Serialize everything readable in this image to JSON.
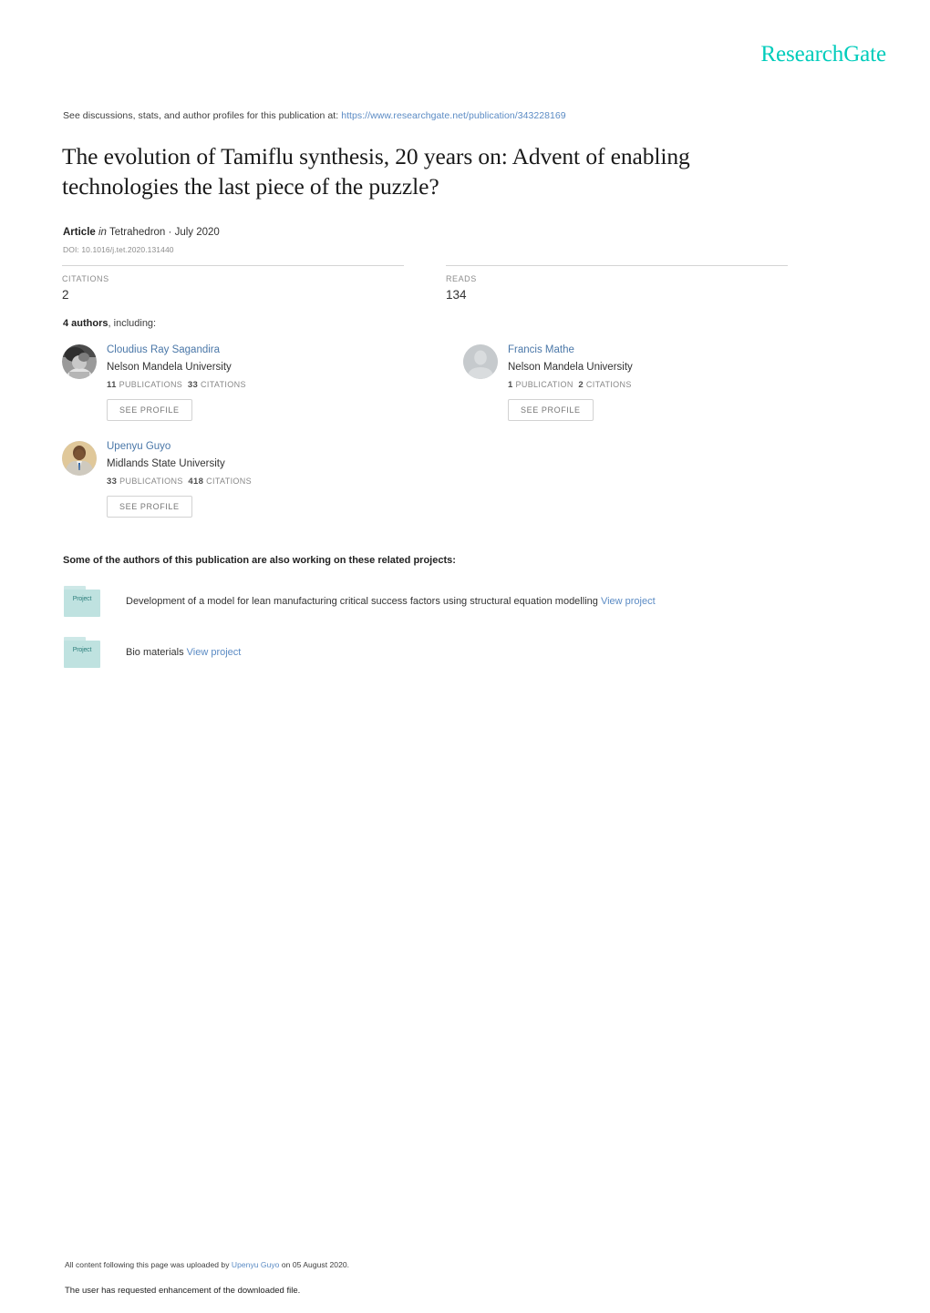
{
  "brand": {
    "name": "ResearchGate",
    "color": "#00ccbb"
  },
  "discussions": {
    "prefix": "See discussions, stats, and author profiles for this publication at:",
    "url": "https://www.researchgate.net/publication/343228169"
  },
  "publication": {
    "title": "The evolution of Tamiflu synthesis, 20 years on: Advent of enabling technologies the last piece of the puzzle?",
    "type": "Article",
    "in_word": "in",
    "journal": "Tetrahedron",
    "separator": "·",
    "date": "July 2020",
    "doi": "DOI: 10.1016/j.tet.2020.131440"
  },
  "stats": [
    {
      "label": "CITATIONS",
      "value": "2"
    },
    {
      "label": "READS",
      "value": "134"
    }
  ],
  "authors_section": {
    "count_text": "4 authors",
    "suffix": ", including:",
    "see_profile_label": "SEE PROFILE",
    "authors": [
      {
        "name": "Cloudius Ray Sagandira",
        "affiliation": "Nelson Mandela University",
        "publications_count": "11",
        "publications_label": "PUBLICATIONS",
        "citations_count": "33",
        "citations_label": "CITATIONS",
        "avatar_type": "photo-grayscale"
      },
      {
        "name": "Francis Mathe",
        "affiliation": "Nelson Mandela University",
        "publications_count": "1",
        "publications_label": "PUBLICATION",
        "citations_count": "2",
        "citations_label": "CITATIONS",
        "avatar_type": "placeholder"
      },
      {
        "name": "Upenyu Guyo",
        "affiliation": "Midlands State University",
        "publications_count": "33",
        "publications_label": "PUBLICATIONS",
        "citations_count": "418",
        "citations_label": "CITATIONS",
        "avatar_type": "photo-color"
      }
    ]
  },
  "projects_section": {
    "heading": "Some of the authors of this publication are also working on these related projects:",
    "icon_label": "Project",
    "view_label": "View project",
    "projects": [
      {
        "title": "Development of a model for lean manufacturing critical success factors using structural equation modelling"
      },
      {
        "title": "Bio materials"
      }
    ]
  },
  "footer": {
    "upload_prefix": "All content following this page was uploaded by",
    "uploader": "Upenyu Guyo",
    "upload_suffix": "on 05 August 2020.",
    "enhancement_note": "The user has requested enhancement of the downloaded file."
  }
}
